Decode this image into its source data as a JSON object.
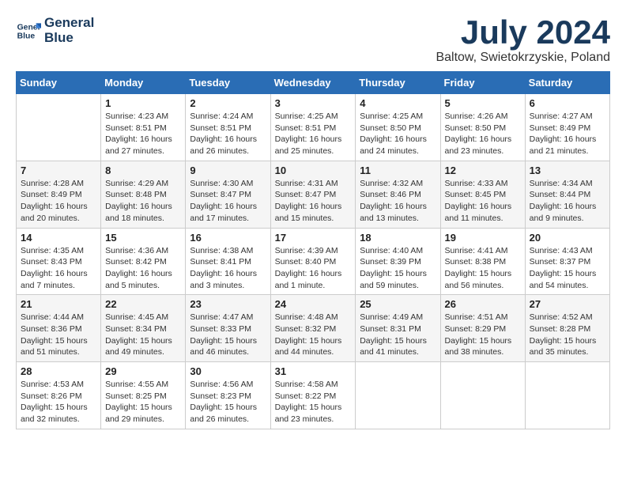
{
  "logo": {
    "line1": "General",
    "line2": "Blue"
  },
  "title": "July 2024",
  "location": "Baltow, Swietokrzyskie, Poland",
  "weekdays": [
    "Sunday",
    "Monday",
    "Tuesday",
    "Wednesday",
    "Thursday",
    "Friday",
    "Saturday"
  ],
  "weeks": [
    [
      {
        "day": "",
        "info": ""
      },
      {
        "day": "1",
        "info": "Sunrise: 4:23 AM\nSunset: 8:51 PM\nDaylight: 16 hours\nand 27 minutes."
      },
      {
        "day": "2",
        "info": "Sunrise: 4:24 AM\nSunset: 8:51 PM\nDaylight: 16 hours\nand 26 minutes."
      },
      {
        "day": "3",
        "info": "Sunrise: 4:25 AM\nSunset: 8:51 PM\nDaylight: 16 hours\nand 25 minutes."
      },
      {
        "day": "4",
        "info": "Sunrise: 4:25 AM\nSunset: 8:50 PM\nDaylight: 16 hours\nand 24 minutes."
      },
      {
        "day": "5",
        "info": "Sunrise: 4:26 AM\nSunset: 8:50 PM\nDaylight: 16 hours\nand 23 minutes."
      },
      {
        "day": "6",
        "info": "Sunrise: 4:27 AM\nSunset: 8:49 PM\nDaylight: 16 hours\nand 21 minutes."
      }
    ],
    [
      {
        "day": "7",
        "info": "Sunrise: 4:28 AM\nSunset: 8:49 PM\nDaylight: 16 hours\nand 20 minutes."
      },
      {
        "day": "8",
        "info": "Sunrise: 4:29 AM\nSunset: 8:48 PM\nDaylight: 16 hours\nand 18 minutes."
      },
      {
        "day": "9",
        "info": "Sunrise: 4:30 AM\nSunset: 8:47 PM\nDaylight: 16 hours\nand 17 minutes."
      },
      {
        "day": "10",
        "info": "Sunrise: 4:31 AM\nSunset: 8:47 PM\nDaylight: 16 hours\nand 15 minutes."
      },
      {
        "day": "11",
        "info": "Sunrise: 4:32 AM\nSunset: 8:46 PM\nDaylight: 16 hours\nand 13 minutes."
      },
      {
        "day": "12",
        "info": "Sunrise: 4:33 AM\nSunset: 8:45 PM\nDaylight: 16 hours\nand 11 minutes."
      },
      {
        "day": "13",
        "info": "Sunrise: 4:34 AM\nSunset: 8:44 PM\nDaylight: 16 hours\nand 9 minutes."
      }
    ],
    [
      {
        "day": "14",
        "info": "Sunrise: 4:35 AM\nSunset: 8:43 PM\nDaylight: 16 hours\nand 7 minutes."
      },
      {
        "day": "15",
        "info": "Sunrise: 4:36 AM\nSunset: 8:42 PM\nDaylight: 16 hours\nand 5 minutes."
      },
      {
        "day": "16",
        "info": "Sunrise: 4:38 AM\nSunset: 8:41 PM\nDaylight: 16 hours\nand 3 minutes."
      },
      {
        "day": "17",
        "info": "Sunrise: 4:39 AM\nSunset: 8:40 PM\nDaylight: 16 hours\nand 1 minute."
      },
      {
        "day": "18",
        "info": "Sunrise: 4:40 AM\nSunset: 8:39 PM\nDaylight: 15 hours\nand 59 minutes."
      },
      {
        "day": "19",
        "info": "Sunrise: 4:41 AM\nSunset: 8:38 PM\nDaylight: 15 hours\nand 56 minutes."
      },
      {
        "day": "20",
        "info": "Sunrise: 4:43 AM\nSunset: 8:37 PM\nDaylight: 15 hours\nand 54 minutes."
      }
    ],
    [
      {
        "day": "21",
        "info": "Sunrise: 4:44 AM\nSunset: 8:36 PM\nDaylight: 15 hours\nand 51 minutes."
      },
      {
        "day": "22",
        "info": "Sunrise: 4:45 AM\nSunset: 8:34 PM\nDaylight: 15 hours\nand 49 minutes."
      },
      {
        "day": "23",
        "info": "Sunrise: 4:47 AM\nSunset: 8:33 PM\nDaylight: 15 hours\nand 46 minutes."
      },
      {
        "day": "24",
        "info": "Sunrise: 4:48 AM\nSunset: 8:32 PM\nDaylight: 15 hours\nand 44 minutes."
      },
      {
        "day": "25",
        "info": "Sunrise: 4:49 AM\nSunset: 8:31 PM\nDaylight: 15 hours\nand 41 minutes."
      },
      {
        "day": "26",
        "info": "Sunrise: 4:51 AM\nSunset: 8:29 PM\nDaylight: 15 hours\nand 38 minutes."
      },
      {
        "day": "27",
        "info": "Sunrise: 4:52 AM\nSunset: 8:28 PM\nDaylight: 15 hours\nand 35 minutes."
      }
    ],
    [
      {
        "day": "28",
        "info": "Sunrise: 4:53 AM\nSunset: 8:26 PM\nDaylight: 15 hours\nand 32 minutes."
      },
      {
        "day": "29",
        "info": "Sunrise: 4:55 AM\nSunset: 8:25 PM\nDaylight: 15 hours\nand 29 minutes."
      },
      {
        "day": "30",
        "info": "Sunrise: 4:56 AM\nSunset: 8:23 PM\nDaylight: 15 hours\nand 26 minutes."
      },
      {
        "day": "31",
        "info": "Sunrise: 4:58 AM\nSunset: 8:22 PM\nDaylight: 15 hours\nand 23 minutes."
      },
      {
        "day": "",
        "info": ""
      },
      {
        "day": "",
        "info": ""
      },
      {
        "day": "",
        "info": ""
      }
    ]
  ]
}
